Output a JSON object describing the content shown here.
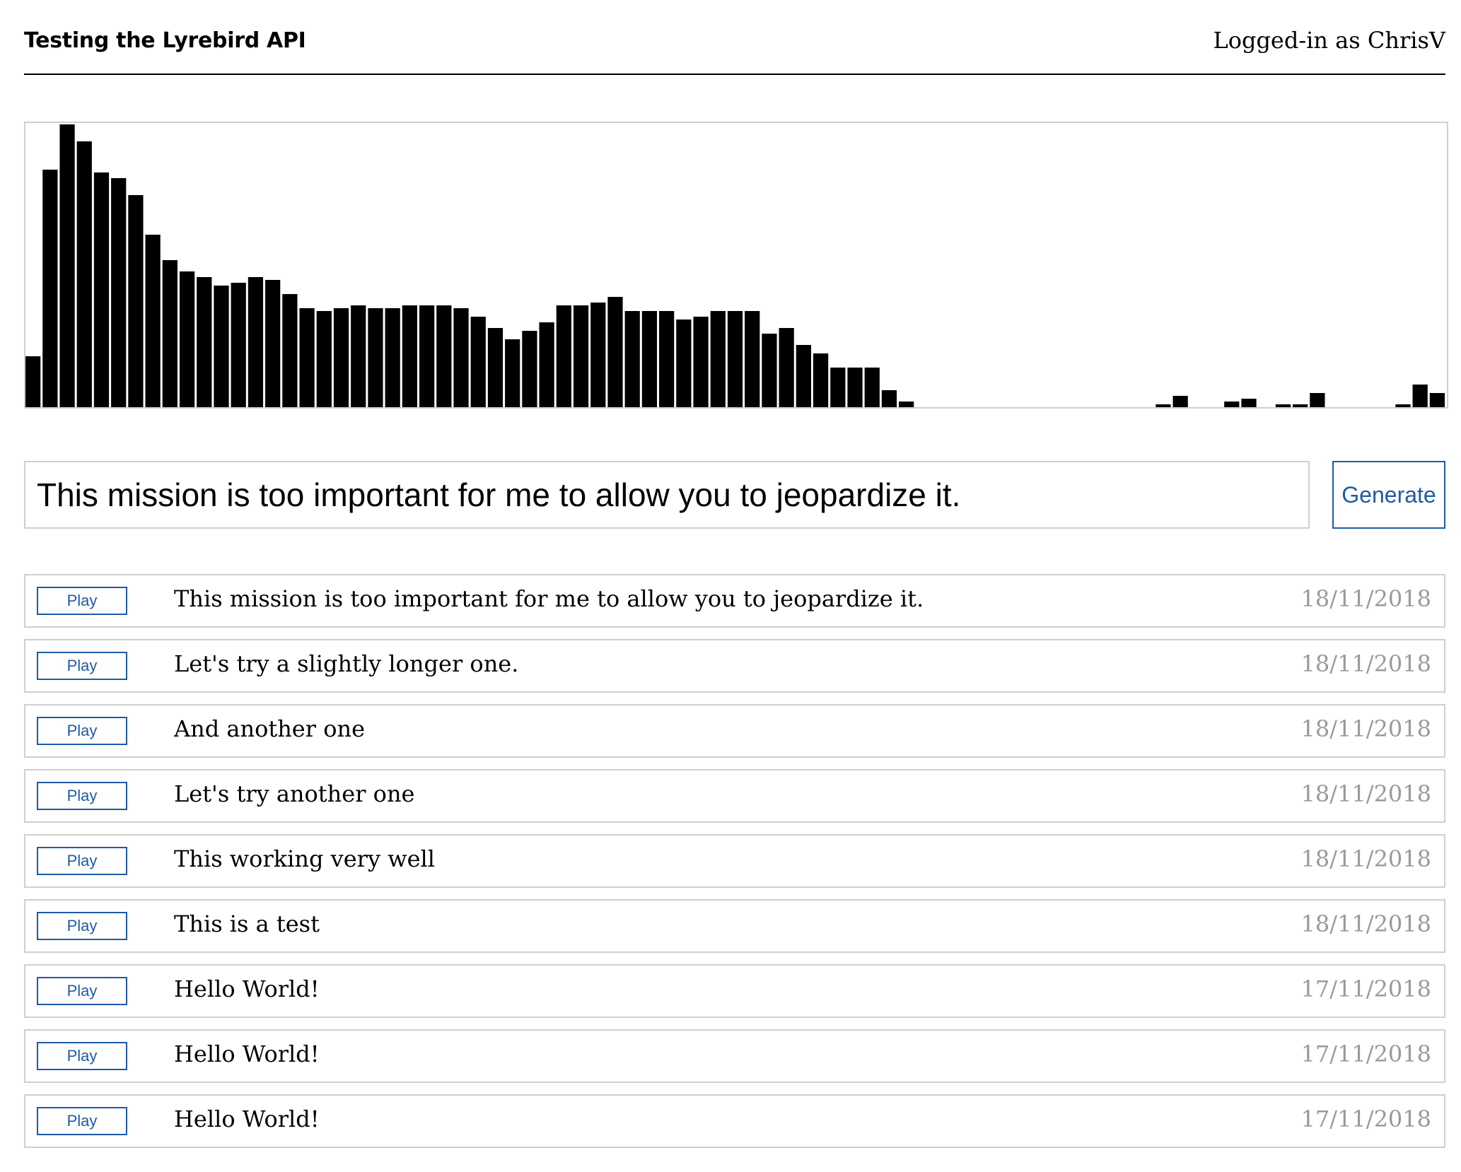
{
  "header": {
    "title": "Testing the Lyrebird API",
    "user": "Logged-in as ChrisV"
  },
  "waveform": {
    "bar_color": "#000000",
    "levels": [
      0.18,
      0.84,
      1.0,
      0.94,
      0.83,
      0.81,
      0.75,
      0.61,
      0.52,
      0.48,
      0.46,
      0.43,
      0.44,
      0.46,
      0.45,
      0.4,
      0.35,
      0.34,
      0.35,
      0.36,
      0.35,
      0.35,
      0.36,
      0.36,
      0.36,
      0.35,
      0.32,
      0.28,
      0.24,
      0.27,
      0.3,
      0.36,
      0.36,
      0.37,
      0.39,
      0.34,
      0.34,
      0.34,
      0.31,
      0.32,
      0.34,
      0.34,
      0.34,
      0.26,
      0.28,
      0.22,
      0.19,
      0.14,
      0.14,
      0.14,
      0.06,
      0.02,
      0,
      0,
      0,
      0,
      0,
      0,
      0,
      0,
      0,
      0,
      0,
      0,
      0,
      0,
      0.01,
      0.04,
      0,
      0,
      0.02,
      0.03,
      0,
      0.01,
      0.01,
      0.05,
      0,
      0,
      0,
      0,
      0.01,
      0.08,
      0.05
    ]
  },
  "composer": {
    "input_value": "This mission is too important for me to allow you to jeopardize it.",
    "generate_label": "Generate"
  },
  "history": [
    {
      "play_label": "Play",
      "text": "This mission is too important for me to allow you to jeopardize it.",
      "date": "18/11/2018"
    },
    {
      "play_label": "Play",
      "text": "Let's try a slightly longer one.",
      "date": "18/11/2018"
    },
    {
      "play_label": "Play",
      "text": "And another one",
      "date": "18/11/2018"
    },
    {
      "play_label": "Play",
      "text": "Let's try another one",
      "date": "18/11/2018"
    },
    {
      "play_label": "Play",
      "text": "This working very well",
      "date": "18/11/2018"
    },
    {
      "play_label": "Play",
      "text": "This is a test",
      "date": "18/11/2018"
    },
    {
      "play_label": "Play",
      "text": "Hello World!",
      "date": "17/11/2018"
    },
    {
      "play_label": "Play",
      "text": "Hello World!",
      "date": "17/11/2018"
    },
    {
      "play_label": "Play",
      "text": "Hello World!",
      "date": "17/11/2018"
    }
  ],
  "colors": {
    "accent": "#1f5aa6",
    "border": "#cfcfcf",
    "date_text": "#9a9a9a"
  }
}
